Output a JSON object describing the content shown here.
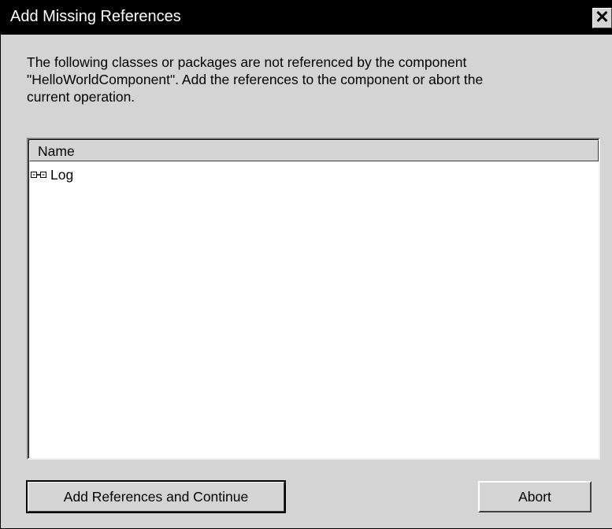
{
  "window": {
    "title": "Add Missing References",
    "close_glyph": "✕"
  },
  "message": {
    "line1": "The following classes or packages are not referenced by the component",
    "line2": "\"HelloWorldComponent\". Add the references to the component or abort the",
    "line3": "current operation."
  },
  "list": {
    "column_header": "Name",
    "items": [
      {
        "label": "Log",
        "icon": "package-reference-icon"
      }
    ]
  },
  "buttons": {
    "add_continue": "Add References and Continue",
    "abort": "Abort"
  }
}
